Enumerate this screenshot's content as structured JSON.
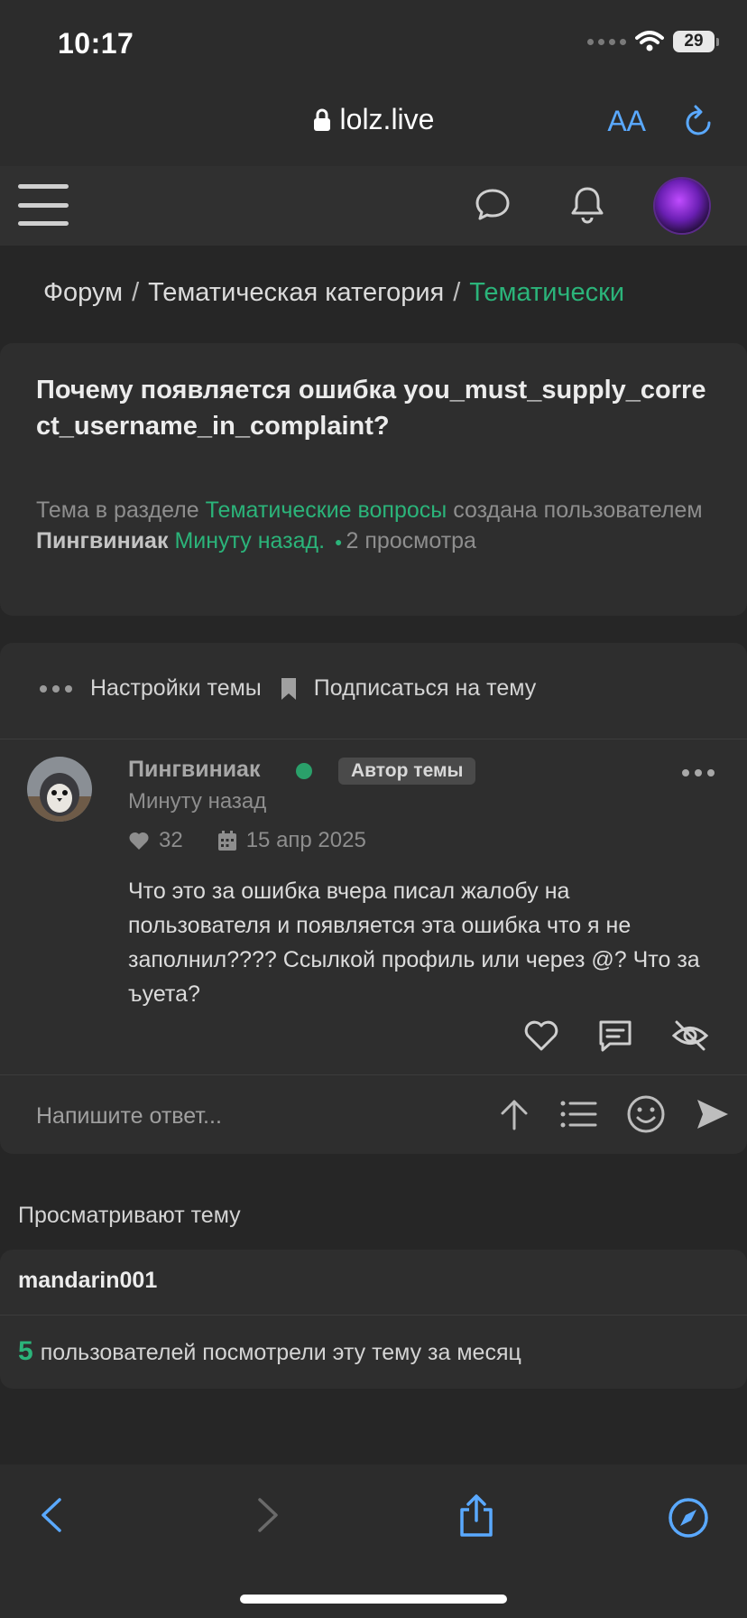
{
  "status_bar": {
    "time": "10:17",
    "battery": "29"
  },
  "browser": {
    "url": "lolz.live",
    "text_size_label": "AA"
  },
  "breadcrumb": {
    "items": [
      "Форум",
      "Тематическая категория"
    ],
    "current": "Тематически",
    "separator": "/"
  },
  "thread": {
    "title": "Почему появляется ошибка you_must_supply_correct_username_in_complaint?",
    "meta_prefix": "Тема в разделе",
    "section": "Тематические вопросы",
    "meta_mid": "создана пользователем",
    "author": "Пингвиниак",
    "created": "Минуту назад.",
    "views": "2 просмотра"
  },
  "thread_tools": {
    "settings": "Настройки темы",
    "subscribe": "Подписаться на тему"
  },
  "post": {
    "author": "Пингвиниак",
    "badge": "Автор темы",
    "time": "Минуту назад",
    "likes": "32",
    "date": "15 апр 2025",
    "text": "Что это за ошибка вчера писал жалобу на пользователя и появляется эта ошибка что я не заполнил???? Ссылкой профиль или через @? Что за ъуета?"
  },
  "reply": {
    "placeholder": "Напишите ответ..."
  },
  "viewers": {
    "title": "Просматривают тему",
    "users": [
      "mandarin001"
    ],
    "month_count": "5",
    "month_text": "пользователей посмотрели эту тему за месяц"
  },
  "colors": {
    "accent": "#2bb47a",
    "link_blue": "#5aa9ff",
    "background": "#262626",
    "card": "#2e2e2e"
  }
}
